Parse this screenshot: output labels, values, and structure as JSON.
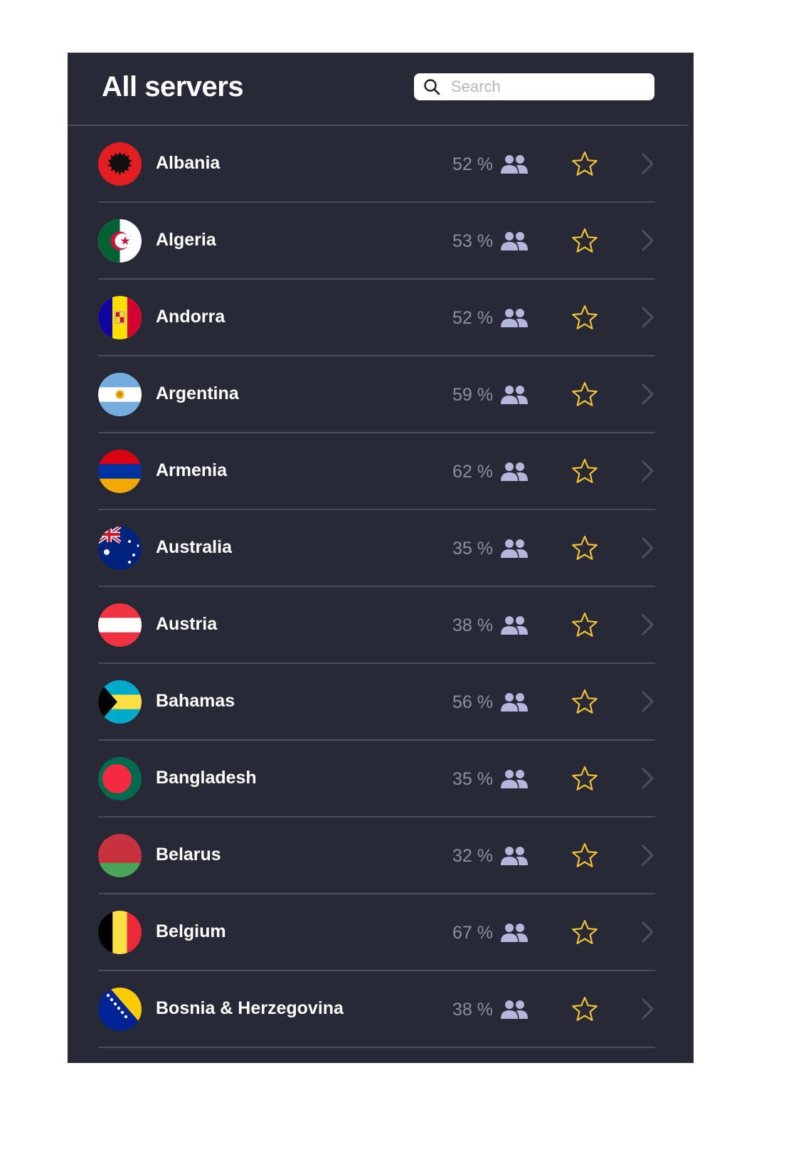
{
  "header": {
    "title": "All servers",
    "search_placeholder": "Search",
    "search_value": ""
  },
  "colors": {
    "panel_bg": "#272936",
    "divider": "#4a4c5a",
    "load_text": "#8c8e9c",
    "users_icon": "#b4b6dc",
    "star": "#f2c330",
    "chevron": "#4c4e5e"
  },
  "icons": {
    "search": "search-icon",
    "users": "users-icon",
    "favorite": "star-outline-icon",
    "open": "chevron-right-icon"
  },
  "servers": [
    {
      "country": "Albania",
      "code": "al",
      "load": "52 %",
      "favorite": false
    },
    {
      "country": "Algeria",
      "code": "dz",
      "load": "53 %",
      "favorite": false
    },
    {
      "country": "Andorra",
      "code": "ad",
      "load": "52 %",
      "favorite": false
    },
    {
      "country": "Argentina",
      "code": "ar",
      "load": "59 %",
      "favorite": false
    },
    {
      "country": "Armenia",
      "code": "am",
      "load": "62 %",
      "favorite": false
    },
    {
      "country": "Australia",
      "code": "au",
      "load": "35 %",
      "favorite": false
    },
    {
      "country": "Austria",
      "code": "at",
      "load": "38 %",
      "favorite": false
    },
    {
      "country": "Bahamas",
      "code": "bs",
      "load": "56 %",
      "favorite": false
    },
    {
      "country": "Bangladesh",
      "code": "bd",
      "load": "35 %",
      "favorite": false
    },
    {
      "country": "Belarus",
      "code": "by",
      "load": "32 %",
      "favorite": false
    },
    {
      "country": "Belgium",
      "code": "be",
      "load": "67 %",
      "favorite": false
    },
    {
      "country": "Bosnia & Herzegovina",
      "code": "ba",
      "load": "38 %",
      "favorite": false
    }
  ]
}
